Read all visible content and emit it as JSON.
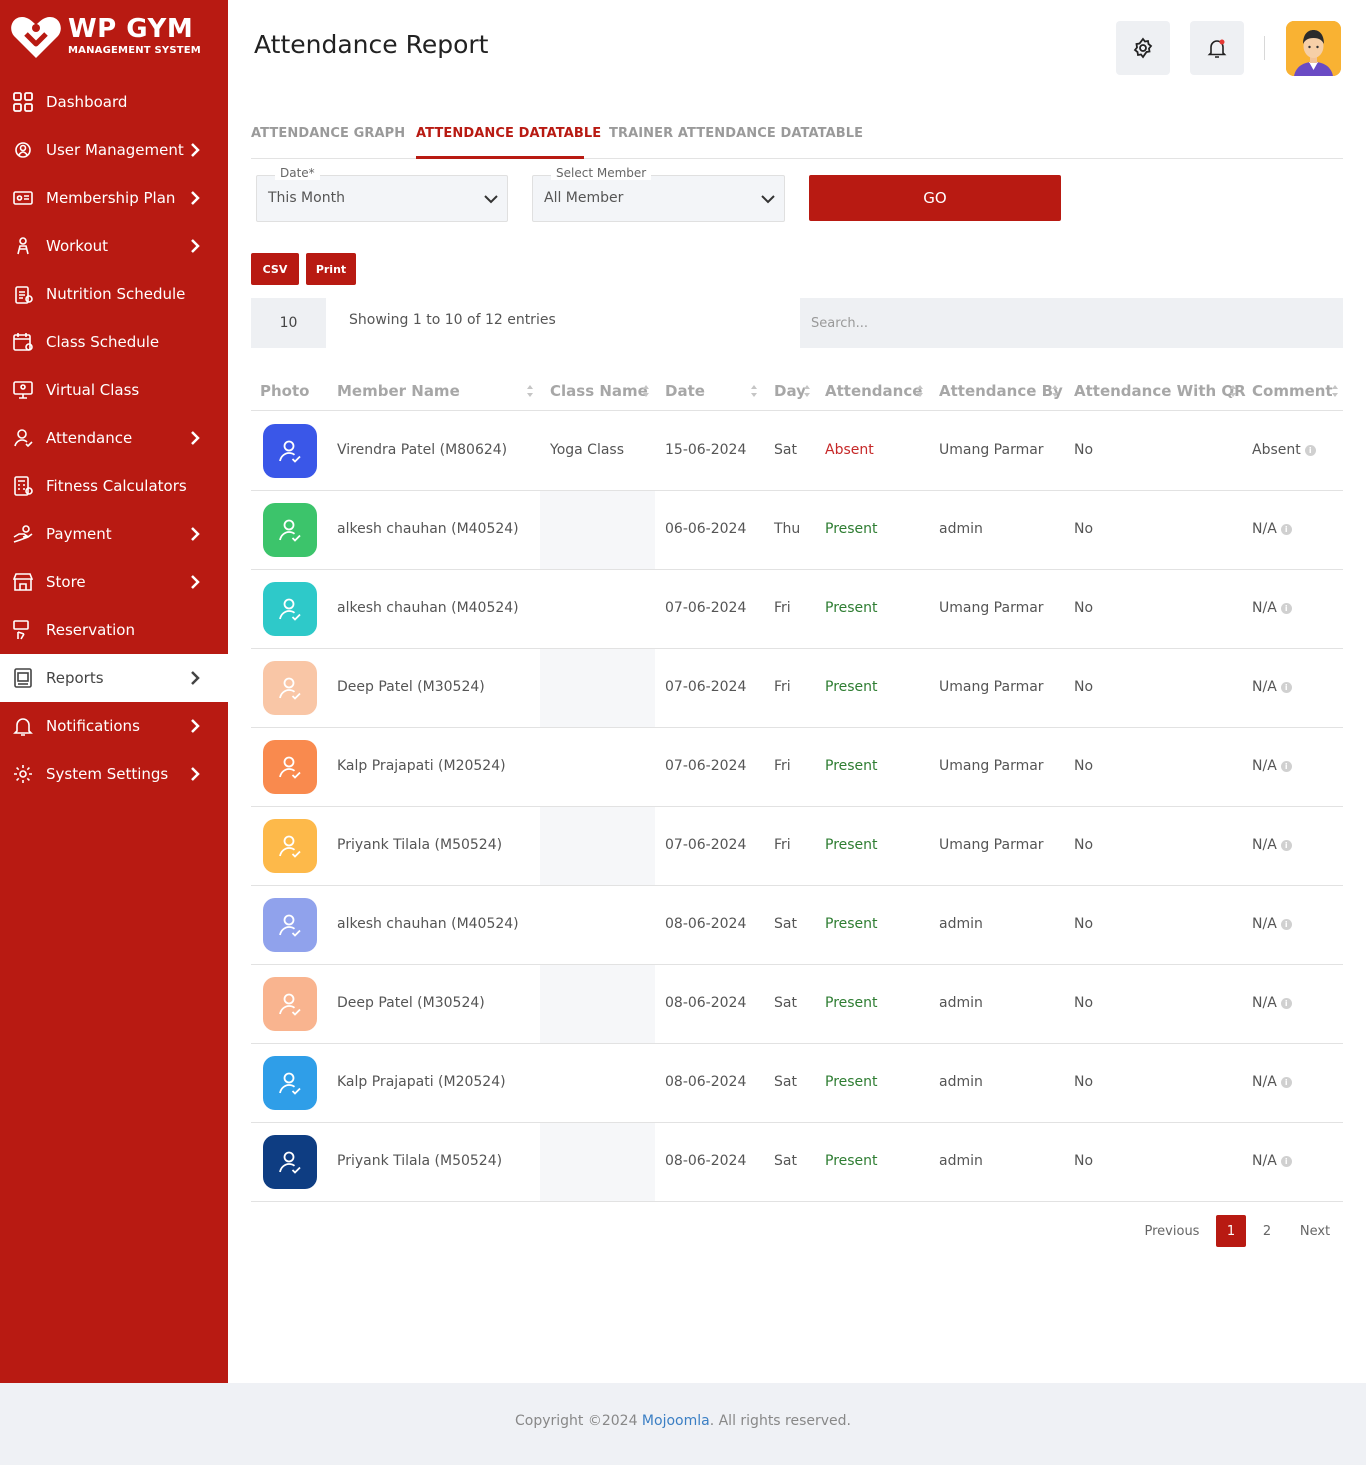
{
  "brand": {
    "title": "WP GYM",
    "subtitle": "MANAGEMENT SYSTEM",
    "color": "#b81a12"
  },
  "sidebar": {
    "items": [
      {
        "label": "Dashboard",
        "icon": "dashboard-grid-icon",
        "chevron": false
      },
      {
        "label": "User Management",
        "icon": "users-gear-icon",
        "chevron": true
      },
      {
        "label": "Membership Plan",
        "icon": "id-card-icon",
        "chevron": true
      },
      {
        "label": "Workout",
        "icon": "workout-icon",
        "chevron": true
      },
      {
        "label": "Nutrition Schedule",
        "icon": "nutrition-clipboard-icon",
        "chevron": false
      },
      {
        "label": "Class Schedule",
        "icon": "calendar-icon",
        "chevron": false
      },
      {
        "label": "Virtual Class",
        "icon": "virtual-class-icon",
        "chevron": false
      },
      {
        "label": "Attendance",
        "icon": "attendance-user-icon",
        "chevron": true
      },
      {
        "label": "Fitness Calculators",
        "icon": "calculator-icon",
        "chevron": false
      },
      {
        "label": "Payment",
        "icon": "payment-hand-icon",
        "chevron": true
      },
      {
        "label": "Store",
        "icon": "store-icon",
        "chevron": true
      },
      {
        "label": "Reservation",
        "icon": "reservation-icon",
        "chevron": false
      },
      {
        "label": "Reports",
        "icon": "report-icon",
        "chevron": true,
        "active": true
      },
      {
        "label": "Notifications",
        "icon": "bell-icon",
        "chevron": true
      },
      {
        "label": "System Settings",
        "icon": "settings-gear-icon",
        "chevron": true
      }
    ]
  },
  "header": {
    "title": "Attendance Report",
    "settings_icon": "gear-icon",
    "notification_icon": "bell-icon",
    "avatar_icon": "user-avatar"
  },
  "tabs": [
    {
      "label": "ATTENDANCE GRAPH",
      "active": false
    },
    {
      "label": "ATTENDANCE DATATABLE",
      "active": true
    },
    {
      "label": "TRAINER ATTENDANCE DATATABLE",
      "active": false
    }
  ],
  "filters": {
    "date_label": "Date*",
    "date_value": "This Month",
    "member_label": "Select Member",
    "member_value": "All Member",
    "go_label": "GO"
  },
  "export": {
    "csv_label": "CSV",
    "print_label": "Print"
  },
  "table_controls": {
    "page_length": "10",
    "info": "Showing 1 to 10 of 12 entries",
    "search_placeholder": "Search..."
  },
  "table": {
    "headers": [
      "Photo",
      "Member Name",
      "Class Name",
      "Date",
      "Day",
      "Attendance",
      "Attendance By",
      "Attendance With QR",
      "Comment"
    ],
    "rows": [
      {
        "photo_color": "#3a57e8",
        "member": "Virendra Patel (M80624)",
        "class": "Yoga Class",
        "date": "15-06-2024",
        "day": "Sat",
        "attendance": "Absent",
        "by": "Umang Parmar",
        "qr": "No",
        "comment": "Absent"
      },
      {
        "photo_color": "#3cc46b",
        "member": "alkesh chauhan (M40524)",
        "class": "",
        "date": "06-06-2024",
        "day": "Thu",
        "attendance": "Present",
        "by": "admin",
        "qr": "No",
        "comment": "N/A"
      },
      {
        "photo_color": "#2ec9c9",
        "member": "alkesh chauhan (M40524)",
        "class": "",
        "date": "07-06-2024",
        "day": "Fri",
        "attendance": "Present",
        "by": "Umang Parmar",
        "qr": "No",
        "comment": "N/A"
      },
      {
        "photo_color": "#f9c6a6",
        "member": "Deep Patel (M30524)",
        "class": "",
        "date": "07-06-2024",
        "day": "Fri",
        "attendance": "Present",
        "by": "Umang Parmar",
        "qr": "No",
        "comment": "N/A"
      },
      {
        "photo_color": "#f98a4e",
        "member": "Kalp Prajapati (M20524)",
        "class": "",
        "date": "07-06-2024",
        "day": "Fri",
        "attendance": "Present",
        "by": "Umang Parmar",
        "qr": "No",
        "comment": "N/A"
      },
      {
        "photo_color": "#fdb94a",
        "member": "Priyank Tilala (M50524)",
        "class": "",
        "date": "07-06-2024",
        "day": "Fri",
        "attendance": "Present",
        "by": "Umang Parmar",
        "qr": "No",
        "comment": "N/A"
      },
      {
        "photo_color": "#90a2ec",
        "member": "alkesh chauhan (M40524)",
        "class": "",
        "date": "08-06-2024",
        "day": "Sat",
        "attendance": "Present",
        "by": "admin",
        "qr": "No",
        "comment": "N/A"
      },
      {
        "photo_color": "#f9b48f",
        "member": "Deep Patel (M30524)",
        "class": "",
        "date": "08-06-2024",
        "day": "Sat",
        "attendance": "Present",
        "by": "admin",
        "qr": "No",
        "comment": "N/A"
      },
      {
        "photo_color": "#2f9ee8",
        "member": "Kalp Prajapati (M20524)",
        "class": "",
        "date": "08-06-2024",
        "day": "Sat",
        "attendance": "Present",
        "by": "admin",
        "qr": "No",
        "comment": "N/A"
      },
      {
        "photo_color": "#0e3d82",
        "member": "Priyank Tilala (M50524)",
        "class": "",
        "date": "08-06-2024",
        "day": "Sat",
        "attendance": "Present",
        "by": "admin",
        "qr": "No",
        "comment": "N/A"
      }
    ]
  },
  "pagination": {
    "previous": "Previous",
    "pages": [
      "1",
      "2"
    ],
    "current": "1",
    "next": "Next"
  },
  "footer": {
    "prefix": "Copyright ©2024 ",
    "brand": "Mojoomla",
    "suffix": ". All rights reserved."
  }
}
